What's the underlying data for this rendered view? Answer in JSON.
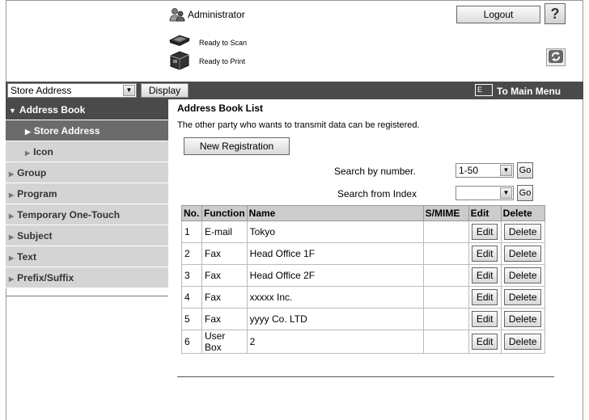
{
  "header": {
    "user_label": "Administrator",
    "logout_label": "Logout",
    "help_label": "?",
    "scan_status": "Ready to Scan",
    "print_status": "Ready to Print"
  },
  "toolbar": {
    "view_select_value": "Store Address",
    "display_label": "Display",
    "main_menu_icon_text": "E",
    "main_menu_label": "To Main Menu"
  },
  "sidebar": {
    "items": [
      {
        "label": "Address Book"
      },
      {
        "label": "Store Address"
      },
      {
        "label": "Icon"
      },
      {
        "label": "Group"
      },
      {
        "label": "Program"
      },
      {
        "label": "Temporary One-Touch"
      },
      {
        "label": "Subject"
      },
      {
        "label": "Text"
      },
      {
        "label": "Prefix/Suffix"
      }
    ]
  },
  "main": {
    "title": "Address Book List",
    "description": "The other party who wants to transmit data can be registered.",
    "new_registration_label": "New Registration",
    "search_number_label": "Search by number.",
    "search_number_value": "1-50",
    "search_index_label": "Search from Index",
    "search_index_value": "",
    "go_label": "Go",
    "table": {
      "headers": [
        "No.",
        "Function",
        "Name",
        "S/MIME",
        "Edit",
        "Delete"
      ],
      "edit_label": "Edit",
      "delete_label": "Delete",
      "rows": [
        {
          "no": "1",
          "function": "E-mail",
          "name": "Tokyo",
          "smime": ""
        },
        {
          "no": "2",
          "function": "Fax",
          "name": "Head Office 1F",
          "smime": ""
        },
        {
          "no": "3",
          "function": "Fax",
          "name": "Head Office 2F",
          "smime": ""
        },
        {
          "no": "4",
          "function": "Fax",
          "name": "xxxxx Inc.",
          "smime": ""
        },
        {
          "no": "5",
          "function": "Fax",
          "name": "yyyy Co. LTD",
          "smime": ""
        },
        {
          "no": "6",
          "function": "User Box",
          "name": "2",
          "smime": ""
        }
      ]
    }
  },
  "icons": {
    "admin": "admin-user-icon",
    "scan": "scanner-icon",
    "print": "printer-icon",
    "refresh": "refresh-icon",
    "main_menu": "main-menu-icon",
    "dropdown": "chevron-down-icon",
    "expand": "triangle-right-icon",
    "collapse": "triangle-down-icon"
  },
  "colors": {
    "bar_dark": "#4a4a4a",
    "sidebar_selected": "#6b6b6b",
    "sidebar_bg": "#d4d4d4",
    "table_header": "#cccccc"
  }
}
